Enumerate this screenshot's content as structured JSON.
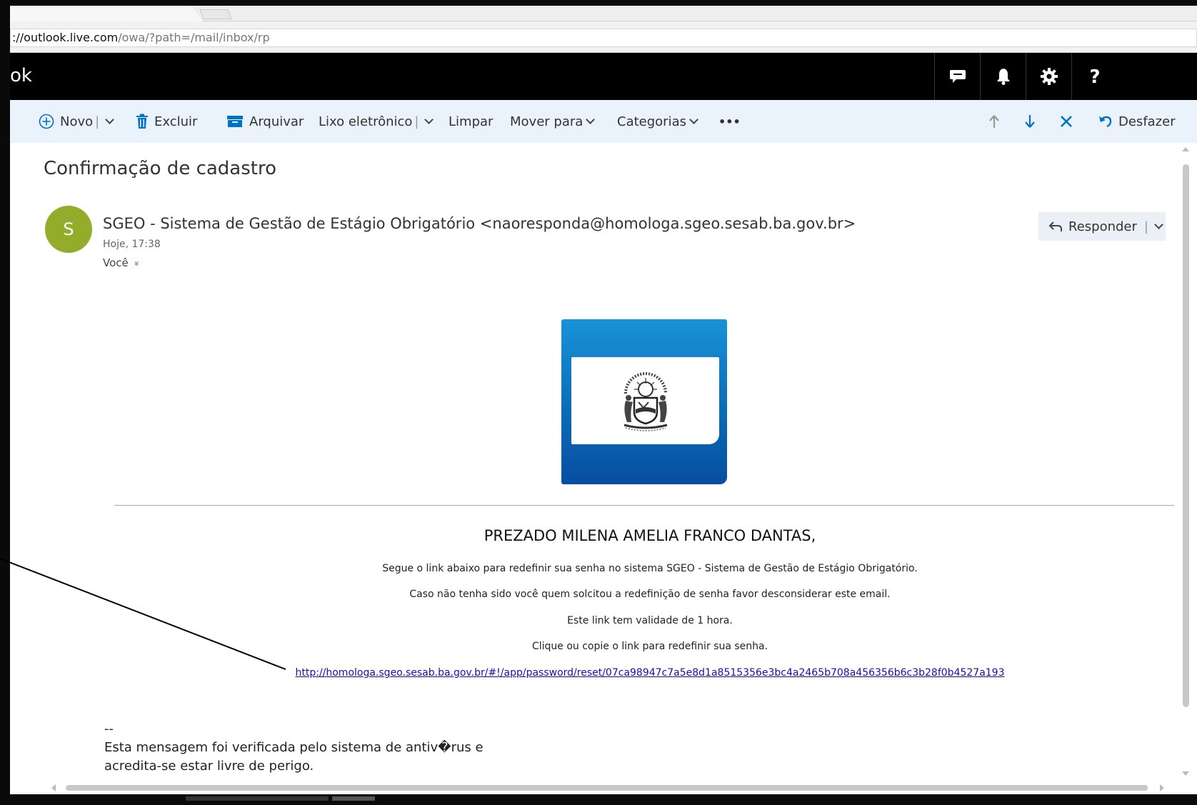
{
  "browser": {
    "url_host": "://outlook.live.com",
    "url_path": "/owa/?path=/mail/inbox/rp"
  },
  "suite": {
    "brand": "ok"
  },
  "toolbar": {
    "new_label": "Novo",
    "delete_label": "Excluir",
    "archive_label": "Arquivar",
    "junk_label": "Lixo eletrônico",
    "sweep_label": "Limpar",
    "move_label": "Mover para",
    "categories_label": "Categorias",
    "more_label": "•••",
    "undo_label": "Desfazer",
    "separator": "|"
  },
  "message": {
    "subject": "Confirmação de cadastro",
    "avatar_initial": "S",
    "sender": "SGEO - Sistema de Gestão de Estágio Obrigatório <naoresponda@homologa.sgeo.sesab.ba.gov.br>",
    "date": "Hoje, 17:38",
    "recipient": "Você",
    "recipient_toggle": "»",
    "reply_label": "Responder"
  },
  "email_body": {
    "greeting": "PREZADO MILENA AMELIA FRANCO DANTAS,",
    "line1": "Segue o link abaixo para redefinir sua senha no sistema SGEO - Sistema de Gestão de Estágio Obrigatório.",
    "line2": "Caso não tenha sido você quem solcitou a redefinição de senha favor desconsiderar este email.",
    "line3": "Este link tem validade de 1 hora.",
    "line4": "Clique ou copie o link para redefinir sua senha.",
    "reset_link": "http://homologa.sgeo.sesab.ba.gov.br/#!/app/password/reset/07ca98947c7a5e8d1a8515356e3bc4a2465b708a456356b6c3b28f0b4527a193",
    "signature_dash": "--",
    "signature_line1": "Esta mensagem foi verificada pelo sistema de antiv�rus e",
    "signature_line2": "acredita-se estar livre de perigo."
  },
  "colors": {
    "command_bar": "#eaf3fb",
    "accent_blue": "#0072c6",
    "avatar": "#93ad2b",
    "link": "#1a0dab"
  },
  "icons": {
    "new": "plus-circle-icon",
    "delete": "trash-icon",
    "archive": "archive-icon",
    "up": "arrow-up-icon",
    "down": "arrow-down-icon",
    "close": "close-icon",
    "undo": "undo-icon",
    "reply": "reply-icon",
    "chat": "chat-icon",
    "bell": "bell-icon",
    "settings": "gear-icon",
    "help": "help-icon"
  }
}
